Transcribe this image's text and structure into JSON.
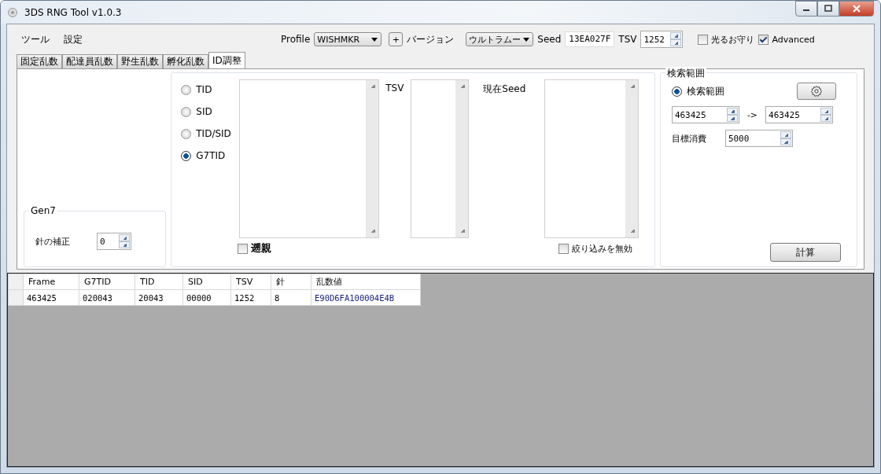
{
  "window": {
    "title": "3DS RNG Tool v1.0.3"
  },
  "menu": [
    "ツール",
    "設定"
  ],
  "toolbar": {
    "profile_label": "Profile",
    "profile": "WISHMKR",
    "add_button": "+",
    "version_label": "バージョン",
    "version": "ウルトラムー",
    "seed_label": "Seed",
    "seed": "13EA027F",
    "tsv_label": "TSV",
    "tsv": "1252",
    "shiny_charm": {
      "label": "光るお守り",
      "checked": false
    },
    "advanced": {
      "label": "Advanced",
      "checked": true
    }
  },
  "tabs": [
    {
      "label": "固定乱数",
      "selected": false
    },
    {
      "label": "配達員乱数",
      "selected": false
    },
    {
      "label": "野生乱数",
      "selected": false
    },
    {
      "label": "孵化乱数",
      "selected": false
    },
    {
      "label": "ID調整",
      "selected": true
    }
  ],
  "gen7": {
    "title": "Gen7",
    "needle_label": "針の補正",
    "needle": "0"
  },
  "id_search": {
    "options": [
      {
        "label": "TID",
        "selected": false
      },
      {
        "label": "SID",
        "selected": false
      },
      {
        "label": "TID/SID",
        "selected": false
      },
      {
        "label": "G7TID",
        "selected": true
      }
    ],
    "tsv_label": "TSV",
    "seed_label": "現在Seed",
    "reverse": {
      "label": "遡親",
      "checked": false
    },
    "disable_filter": {
      "label": "絞り込みを無効",
      "checked": false
    }
  },
  "search_range": {
    "title": "検索範囲",
    "radio": {
      "label": "検索範囲",
      "selected": true
    },
    "from": "463425",
    "arrow": "->",
    "to": "463425",
    "target_label": "目標消費",
    "target": "5000",
    "calc_button": "計算"
  },
  "results": {
    "columns": [
      "Frame",
      "G7TID",
      "TID",
      "SID",
      "TSV",
      "針",
      "乱数値"
    ],
    "rows": [
      [
        "463425",
        "020043",
        "20043",
        "00000",
        "1252",
        "8",
        "E90D6FA100004E4B"
      ]
    ]
  }
}
